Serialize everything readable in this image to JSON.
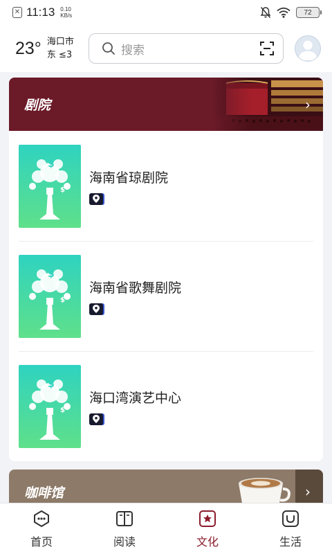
{
  "status_bar": {
    "time": "11:13",
    "speed_value": "0.10",
    "speed_unit": "KB/s",
    "battery": "72"
  },
  "header": {
    "temperature": "23°",
    "city": "海口市",
    "wind": "东  ≤3",
    "search_placeholder": "搜索"
  },
  "sections": [
    {
      "title": "剧院",
      "items": [
        {
          "name": "海南省琼剧院"
        },
        {
          "name": "海南省歌舞剧院"
        },
        {
          "name": "海口湾演艺中心"
        }
      ]
    },
    {
      "title": "咖啡馆"
    }
  ],
  "tabs": [
    {
      "label": "首页",
      "icon": "home-icon"
    },
    {
      "label": "阅读",
      "icon": "book-icon"
    },
    {
      "label": "文化",
      "icon": "culture-star-icon"
    },
    {
      "label": "生活",
      "icon": "life-icon"
    }
  ],
  "colors": {
    "accent": "#8b1c2c",
    "theater_banner": "#6b1a28",
    "coffee_banner": "#8d7a68"
  }
}
